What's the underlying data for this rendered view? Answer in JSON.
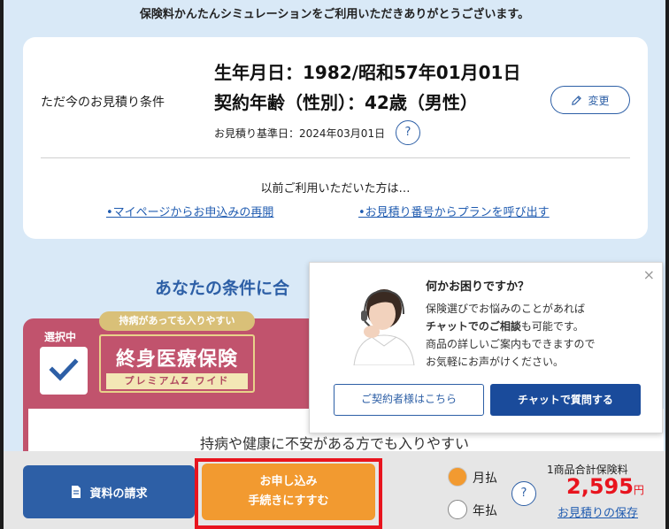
{
  "header": {
    "thanks": "保険料かんたんシミュレーションをご利用いただきありがとうございます。"
  },
  "estimate": {
    "condition_label": "ただ今のお見積り条件",
    "birth": "生年月日：1982/昭和57年01月01日",
    "age": "契約年齢（性別）：42歳（男性）",
    "base_date": "お見積り基準日：2024年03月01日",
    "help_icon_text": "?",
    "change_label": "変更",
    "previous_users": "以前ご利用いただいた方は…",
    "link_mypage": "•マイページからお申込みの再開",
    "link_estimate_number": "•お見積り番号からプランを呼び出す"
  },
  "section": {
    "title": "あなたの条件に合"
  },
  "plan": {
    "selected_label": "選択中",
    "ribbon": "持病があっても入りやすい",
    "name": "終身医療保険",
    "sub": "プレミアムZ ワイド",
    "tagline": "持病や健康に不安がある方でも入りやすい"
  },
  "popup": {
    "close_icon": "×",
    "title": "何かお困りですか？",
    "line1": "保険選びでお悩みのことがあれば",
    "line2_bold": "チャットでのご相談",
    "line2_rest": "も可能です。",
    "line3": "商品の詳しいご案内もできますので",
    "line4": "お気軽にお声がけください。",
    "contract_button": "ご契約者様はこちら",
    "chat_button": "チャットで質問する"
  },
  "bottom": {
    "request_button": "資料の請求",
    "apply_line1": "お申し込み",
    "apply_line2": "手続きにすすむ",
    "monthly": "月払",
    "yearly": "年払",
    "selected_payment": "月払",
    "help_icon_text": "?",
    "total_label": "1商品合計保険料",
    "price": "2,595",
    "price_unit": "円",
    "save_link": "お見積りの保存"
  },
  "colors": {
    "brand_blue": "#2d5fa6",
    "plan_pink": "#c1536d",
    "apply_orange": "#f29a30",
    "price_red": "#e8141e"
  }
}
